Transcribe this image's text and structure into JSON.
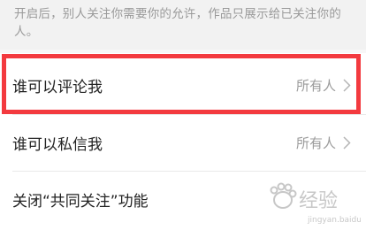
{
  "hint": {
    "text": "开启后，别人关注你需要你的允许，作品只展示给已关注你的人。"
  },
  "settings": {
    "items": [
      {
        "label": "谁可以评论我",
        "value": "所有人",
        "chevron": "chevron-right-icon",
        "highlighted": true
      },
      {
        "label": "谁可以私信我",
        "value": "所有人",
        "chevron": "chevron-right-icon"
      },
      {
        "label": "关闭“共同关注”功能"
      }
    ]
  },
  "colors": {
    "highlight_border": "#f33a3f",
    "label_text": "#222222",
    "value_text": "#9b9b9b",
    "hint_text": "#9a9a9a"
  },
  "watermark": {
    "brand": "Baidu",
    "text": "经验",
    "url": "jingyan.baidu.com"
  }
}
